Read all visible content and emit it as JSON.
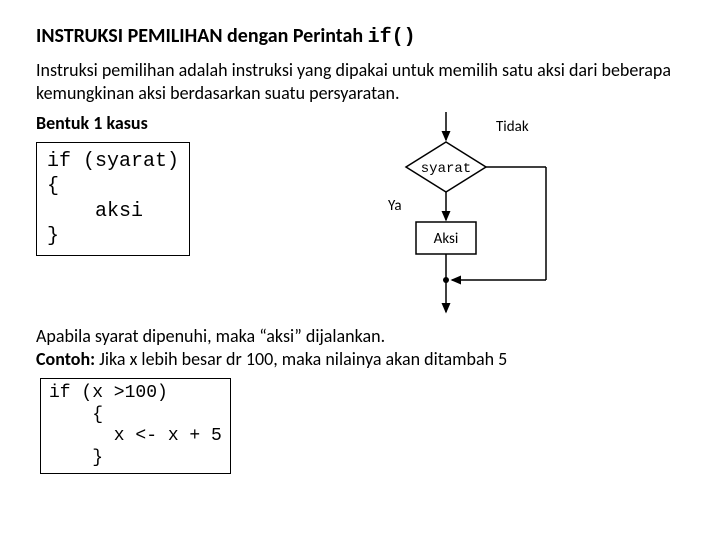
{
  "title_prefix": "INSTRUKSI PEMILIHAN dengan Perintah ",
  "title_code": "if()",
  "intro": "Instruksi pemilihan adalah instruksi yang dipakai untuk memilih satu aksi dari beberapa kemungkinan aksi berdasarkan suatu persyaratan.",
  "subtitle": "Bentuk 1 kasus",
  "code1": "if (syarat)\n{\n    aksi\n}",
  "flowchart": {
    "condition": "syarat",
    "yes": "Ya",
    "no": "Tidak",
    "action": "Aksi"
  },
  "explain1": "Apabila syarat dipenuhi, maka “aksi” dijalankan.",
  "contoh_label": "Contoh:",
  "contoh_text": " Jika x lebih besar dr 100, maka nilainya akan ditambah 5",
  "code2": "if (x >100)\n    {\n      x <- x + 5\n    }"
}
